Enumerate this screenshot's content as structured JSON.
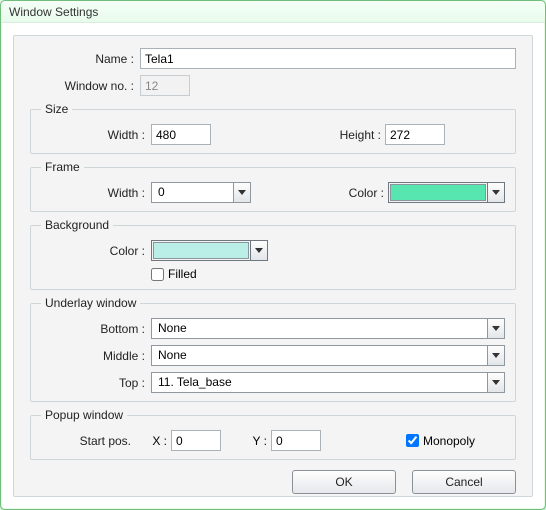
{
  "title": "Window Settings",
  "name": {
    "label": "Name :",
    "value": "Tela1"
  },
  "window_no": {
    "label": "Window no. :",
    "value": "12"
  },
  "size": {
    "legend": "Size",
    "width": {
      "label": "Width :",
      "value": "480"
    },
    "height": {
      "label": "Height :",
      "value": "272"
    }
  },
  "frame": {
    "legend": "Frame",
    "width": {
      "label": "Width :",
      "value": "0"
    },
    "color": {
      "label": "Color :",
      "value": "#57e6b0"
    }
  },
  "background": {
    "legend": "Background",
    "color": {
      "label": "Color :",
      "value": "#b9efe6"
    },
    "filled": {
      "label": "Filled",
      "checked": false
    }
  },
  "underlay": {
    "legend": "Underlay window",
    "bottom": {
      "label": "Bottom :",
      "value": "None"
    },
    "middle": {
      "label": "Middle :",
      "value": "None"
    },
    "top": {
      "label": "Top :",
      "value": "11. Tela_base"
    }
  },
  "popup": {
    "legend": "Popup window",
    "start_label": "Start pos.",
    "x": {
      "label": "X :",
      "value": "0"
    },
    "y": {
      "label": "Y :",
      "value": "0"
    },
    "monopoly": {
      "label": "Monopoly",
      "checked": true
    }
  },
  "buttons": {
    "ok": "OK",
    "cancel": "Cancel"
  }
}
